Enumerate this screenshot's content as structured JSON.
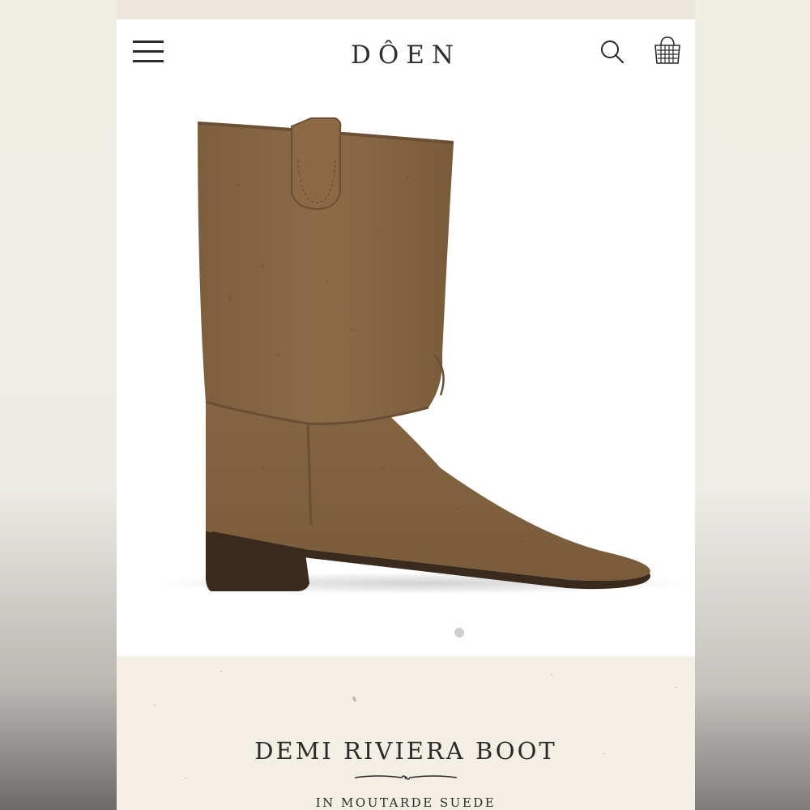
{
  "brand": {
    "name": "DÔEN"
  },
  "header": {
    "menu_icon": "hamburger-menu-icon",
    "search_icon": "search-icon",
    "bag_icon": "shopping-basket-icon"
  },
  "product": {
    "image_description_icon": "boot-image",
    "title": "DEMI RIVIERA BOOT",
    "subtitle": "IN MOUTARDE SUEDE",
    "carousel_dots": 1
  },
  "colors": {
    "suede": "#8a6a45",
    "panel_bg": "#f3efe4",
    "text": "#2b2b2b"
  }
}
